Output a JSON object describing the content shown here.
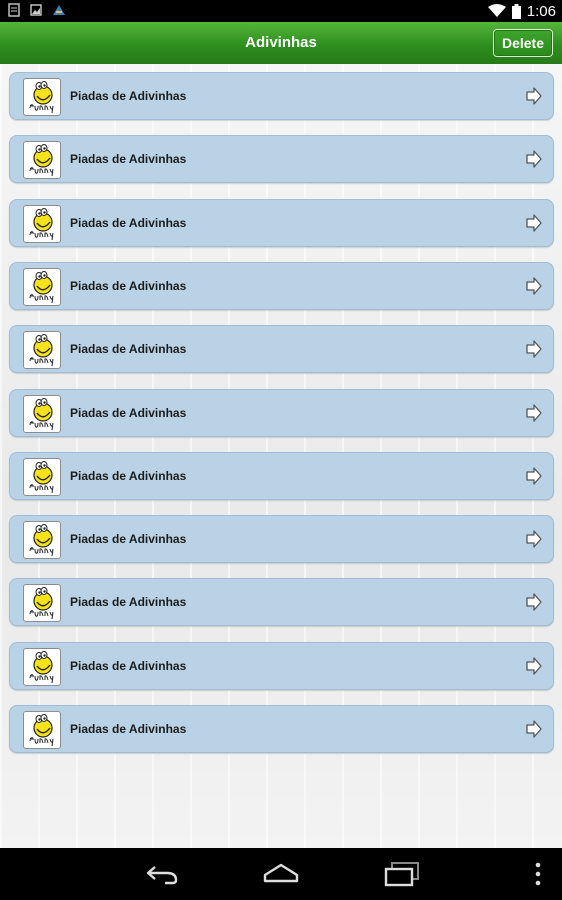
{
  "status_bar": {
    "time": "1:06",
    "icons": [
      "notification-icon",
      "image-icon",
      "app-icon",
      "wifi-icon",
      "battery-icon"
    ]
  },
  "action_bar": {
    "title": "Adivinhas",
    "delete_label": "Delete",
    "color": "#2e8f1f"
  },
  "list": {
    "items": [
      {
        "label": "Piadas de Adivinhas",
        "thumb_icon": "funny-smiley-icon"
      },
      {
        "label": "Piadas de Adivinhas",
        "thumb_icon": "funny-smiley-icon"
      },
      {
        "label": "Piadas de Adivinhas",
        "thumb_icon": "funny-smiley-icon"
      },
      {
        "label": "Piadas de Adivinhas",
        "thumb_icon": "funny-smiley-icon"
      },
      {
        "label": "Piadas de Adivinhas",
        "thumb_icon": "funny-smiley-icon"
      },
      {
        "label": "Piadas de Adivinhas",
        "thumb_icon": "funny-smiley-icon"
      },
      {
        "label": "Piadas de Adivinhas",
        "thumb_icon": "funny-smiley-icon"
      },
      {
        "label": "Piadas de Adivinhas",
        "thumb_icon": "funny-smiley-icon"
      },
      {
        "label": "Piadas de Adivinhas",
        "thumb_icon": "funny-smiley-icon"
      },
      {
        "label": "Piadas de Adivinhas",
        "thumb_icon": "funny-smiley-icon"
      },
      {
        "label": "Piadas de Adivinhas",
        "thumb_icon": "funny-smiley-icon"
      }
    ],
    "item_color": "#b9d2e6"
  },
  "nav_bar": {
    "buttons": [
      "back-icon",
      "home-icon",
      "recents-icon",
      "menu-icon"
    ]
  }
}
